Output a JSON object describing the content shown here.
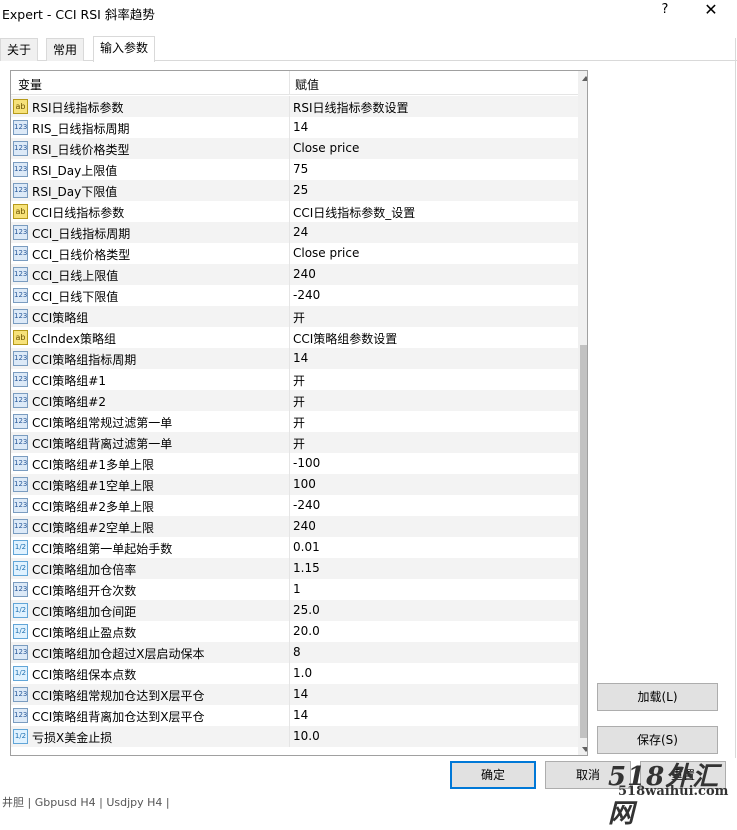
{
  "window": {
    "title": "Expert - CCI RSI 斜率趋势",
    "help": "?",
    "close": "✕"
  },
  "tabs": [
    "关于",
    "常用",
    "输入参数"
  ],
  "grid": {
    "col_name": "变量",
    "col_value": "赋值",
    "rows": [
      {
        "icon": "ab",
        "name": "RSI日线指标参数",
        "value": "RSI日线指标参数设置"
      },
      {
        "icon": "123",
        "name": "RIS_日线指标周期",
        "value": "14"
      },
      {
        "icon": "123",
        "name": "RSI_日线价格类型",
        "value": "Close price"
      },
      {
        "icon": "123",
        "name": "RSI_Day上限值",
        "value": "75"
      },
      {
        "icon": "123",
        "name": "RSI_Day下限值",
        "value": "25"
      },
      {
        "icon": "ab",
        "name": "CCI日线指标参数",
        "value": "CCI日线指标参数_设置"
      },
      {
        "icon": "123",
        "name": "CCI_日线指标周期",
        "value": "24"
      },
      {
        "icon": "123",
        "name": "CCI_日线价格类型",
        "value": "Close price"
      },
      {
        "icon": "123",
        "name": "CCI_日线上限值",
        "value": "240"
      },
      {
        "icon": "123",
        "name": "CCI_日线下限值",
        "value": "-240"
      },
      {
        "icon": "123",
        "name": "CCI策略组",
        "value": "开"
      },
      {
        "icon": "ab",
        "name": "CcIndex策略组",
        "value": "CCI策略组参数设置"
      },
      {
        "icon": "123",
        "name": "CCI策略组指标周期",
        "value": "14"
      },
      {
        "icon": "123",
        "name": "CCI策略组#1",
        "value": "开"
      },
      {
        "icon": "123",
        "name": "CCI策略组#2",
        "value": "开"
      },
      {
        "icon": "123",
        "name": "CCI策略组常规过滤第一单",
        "value": "开"
      },
      {
        "icon": "123",
        "name": "CCI策略组背离过滤第一单",
        "value": "开"
      },
      {
        "icon": "123",
        "name": "CCI策略组#1多单上限",
        "value": "-100"
      },
      {
        "icon": "123",
        "name": "CCI策略组#1空单上限",
        "value": "100"
      },
      {
        "icon": "123",
        "name": "CCI策略组#2多单上限",
        "value": "-240"
      },
      {
        "icon": "123",
        "name": "CCI策略组#2空单上限",
        "value": "240"
      },
      {
        "icon": "1/2",
        "name": "CCI策略组第一单起始手数",
        "value": "0.01"
      },
      {
        "icon": "1/2",
        "name": "CCI策略组加仓倍率",
        "value": "1.15"
      },
      {
        "icon": "123",
        "name": "CCI策略组开仓次数",
        "value": "1"
      },
      {
        "icon": "1/2",
        "name": "CCI策略组加仓间距",
        "value": "25.0"
      },
      {
        "icon": "1/2",
        "name": "CCI策略组止盈点数",
        "value": "20.0"
      },
      {
        "icon": "123",
        "name": "CCI策略组加仓超过X层启动保本",
        "value": "8"
      },
      {
        "icon": "1/2",
        "name": "CCI策略组保本点数",
        "value": "1.0"
      },
      {
        "icon": "123",
        "name": "CCI策略组常规加仓达到X层平仓",
        "value": "14"
      },
      {
        "icon": "123",
        "name": "CCI策略组背离加仓达到X层平仓",
        "value": "14"
      },
      {
        "icon": "1/2",
        "name": "亏损X美金止损",
        "value": "10.0"
      }
    ]
  },
  "buttons": {
    "load": "加载(L)",
    "save": "保存(S)",
    "ok": "确定",
    "cancel": "取消",
    "reset": "重置"
  },
  "watermark": {
    "big": "518外汇网",
    "small": "518waihui.com"
  },
  "background_text": "井胆 | Gbpusd H4 | Usdjpy H4 |"
}
